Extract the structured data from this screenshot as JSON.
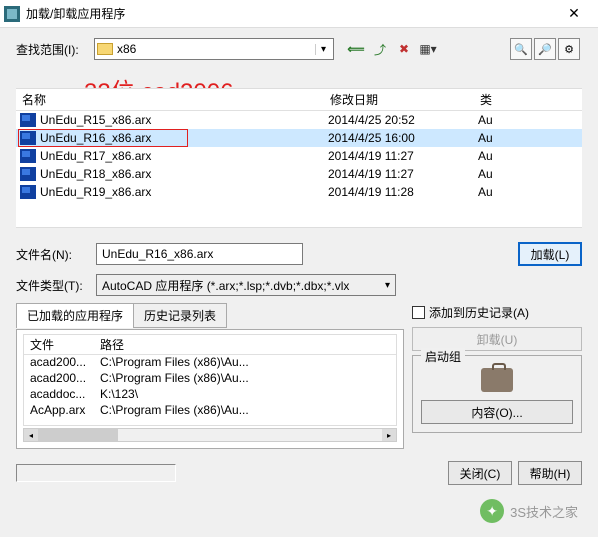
{
  "window": {
    "title": "加载/卸载应用程序",
    "close": "✕"
  },
  "lookIn": {
    "label": "查找范围(I):",
    "value": "x86"
  },
  "navIcons": {
    "back": "back-icon",
    "up": "up-icon",
    "refresh": "refresh-icon",
    "views": "views-icon"
  },
  "rightTools": {
    "find": "🔍",
    "magnify": "🔎",
    "tool": "⚙"
  },
  "annotation": "32位 cad2006",
  "listHeaders": {
    "name": "名称",
    "date": "修改日期",
    "type": "类"
  },
  "files": [
    {
      "name": "UnEdu_R15_x86.arx",
      "date": "2014/4/25 20:52",
      "type": "Au"
    },
    {
      "name": "UnEdu_R16_x86.arx",
      "date": "2014/4/25 16:00",
      "type": "Au"
    },
    {
      "name": "UnEdu_R17_x86.arx",
      "date": "2014/4/19 11:27",
      "type": "Au"
    },
    {
      "name": "UnEdu_R18_x86.arx",
      "date": "2014/4/19 11:27",
      "type": "Au"
    },
    {
      "name": "UnEdu_R19_x86.arx",
      "date": "2014/4/19 11:28",
      "type": "Au"
    }
  ],
  "selectedFileIdx": 1,
  "form": {
    "fileNameLabel": "文件名(N):",
    "fileNameValue": "UnEdu_R16_x86.arx",
    "fileTypeLabel": "文件类型(T):",
    "fileTypeValue": "AutoCAD 应用程序 (*.arx;*.lsp;*.dvb;*.dbx;*.vlx",
    "loadBtn": "加载(L)"
  },
  "tabs": {
    "loaded": "已加载的应用程序",
    "history": "历史记录列表"
  },
  "loadedHeaders": {
    "file": "文件",
    "path": "路径"
  },
  "loadedRows": [
    {
      "file": "acad200...",
      "path": "C:\\Program Files (x86)\\Au..."
    },
    {
      "file": "acad200...",
      "path": "C:\\Program Files (x86)\\Au..."
    },
    {
      "file": "acaddoc...",
      "path": "K:\\123\\"
    },
    {
      "file": "AcApp.arx",
      "path": "C:\\Program Files (x86)\\Au..."
    }
  ],
  "right": {
    "addHistory": "添加到历史记录(A)",
    "unload": "卸载(U)",
    "startup": "启动组",
    "content": "内容(O)..."
  },
  "bottom": {
    "close": "关闭(C)",
    "help": "帮助(H)"
  },
  "watermark": "3S技术之家"
}
